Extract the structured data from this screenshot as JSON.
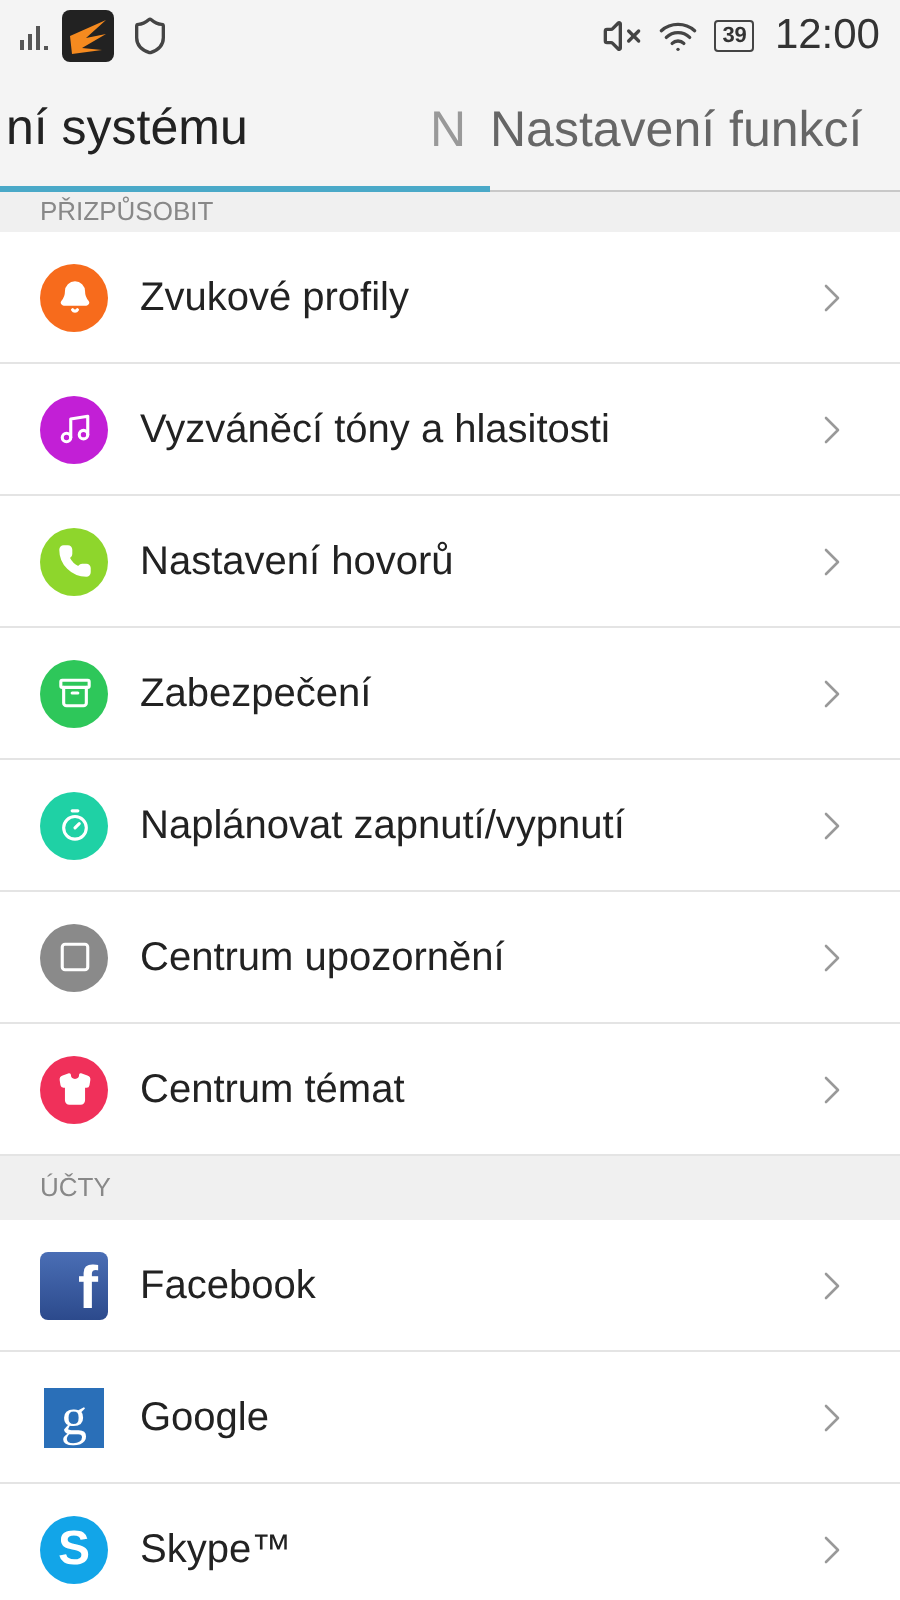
{
  "status_bar": {
    "battery": "39",
    "time": "12:00"
  },
  "tabs": [
    {
      "label": "ní systému",
      "selected": true
    },
    {
      "label": "N",
      "selected": false
    },
    {
      "label": "Nastavení funkcí",
      "selected": false
    }
  ],
  "sections": [
    {
      "title": "PŘIZPŮSOBIT",
      "items": [
        {
          "label": "Zvukové profily",
          "kind": "bell",
          "color": "#f76b1c"
        },
        {
          "label": "Vyzváněcí tóny a hlasitosti",
          "kind": "music",
          "color": "#c21fd6"
        },
        {
          "label": "Nastavení hovorů",
          "kind": "phone",
          "color": "#8ed62c"
        },
        {
          "label": "Zabezpečení",
          "kind": "safe",
          "color": "#2ec75a"
        },
        {
          "label": "Naplánovat zapnutí/vypnutí",
          "kind": "timer",
          "color": "#1fd1a5"
        },
        {
          "label": "Centrum upozornění",
          "kind": "note",
          "color": "#8a8a8a"
        },
        {
          "label": "Centrum témat",
          "kind": "shirt",
          "color": "#f0305a"
        }
      ]
    },
    {
      "title": "ÚČTY",
      "items": [
        {
          "label": "Facebook",
          "kind": "facebook",
          "glyph": "f"
        },
        {
          "label": "Google",
          "kind": "google",
          "glyph": "g"
        },
        {
          "label": "Skype™",
          "kind": "skype",
          "glyph": "S"
        }
      ]
    }
  ]
}
